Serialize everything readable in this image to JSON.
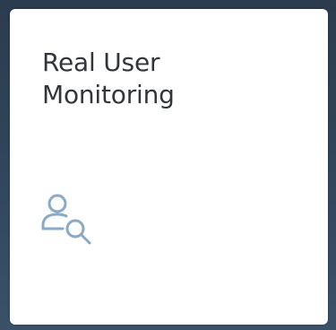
{
  "tile": {
    "title": "Real User\nMonitoring",
    "icon": "user-search-icon",
    "icon_color": "#89a9c8",
    "background": "#ffffff",
    "title_color": "#32363a"
  }
}
